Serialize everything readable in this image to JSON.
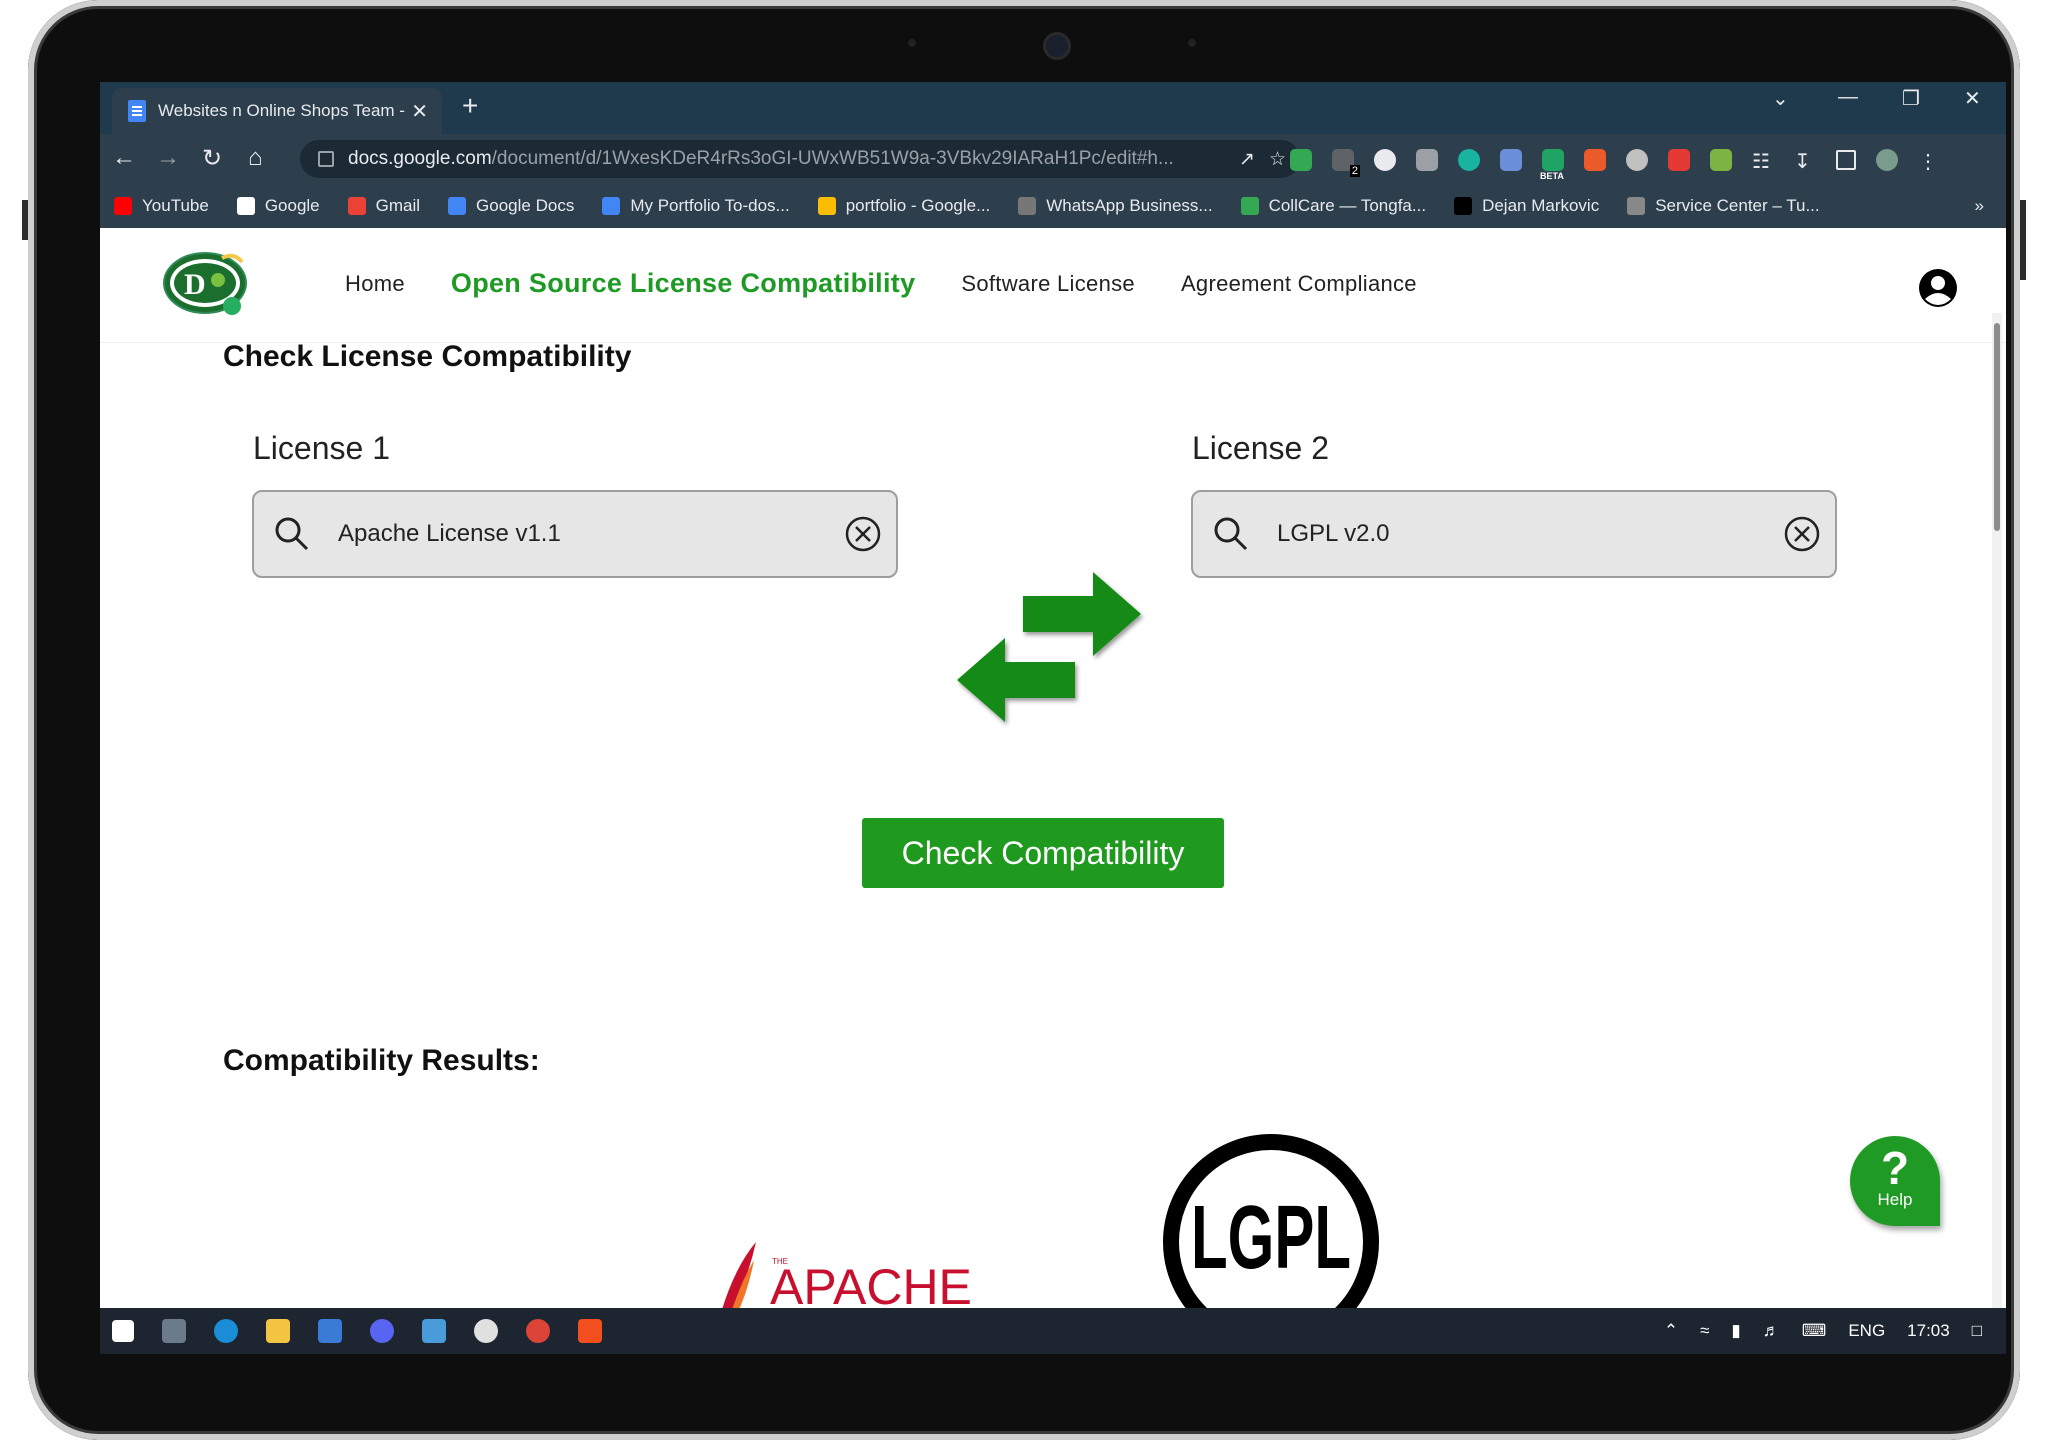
{
  "browser": {
    "tab_title": "Websites n Online Shops Team -",
    "tab_close": "✕",
    "new_tab": "+",
    "url_host": "docs.google.com",
    "url_path": "/document/d/1WxesKDeR4rRs3oGI-UWxWB51W9a-3VBkv29IARaH1Pc/edit#h...",
    "extension_badge": "2",
    "extension_beta": "BETA",
    "bookmarks": [
      {
        "label": "YouTube",
        "color": "#ff0000"
      },
      {
        "label": "Google",
        "color": "#ffffff"
      },
      {
        "label": "Gmail",
        "color": "#ea4335"
      },
      {
        "label": "Google Docs",
        "color": "#4285f4"
      },
      {
        "label": "My Portfolio To-dos...",
        "color": "#4285f4"
      },
      {
        "label": "portfolio - Google...",
        "color": "#fbbc04"
      },
      {
        "label": "WhatsApp Business...",
        "color": "#777777"
      },
      {
        "label": "CollCare — Tongfa...",
        "color": "#34a853"
      },
      {
        "label": "Dejan Markovic",
        "color": "#000000"
      },
      {
        "label": "Service Center – Tu...",
        "color": "#888888"
      }
    ],
    "bookmarks_more": "»"
  },
  "site": {
    "nav": {
      "home": "Home",
      "compat": "Open Source License Compatibility",
      "software": "Software License",
      "agreement": "Agreement Compliance"
    },
    "heading": "Check License Compatibility",
    "license1": {
      "label": "License 1",
      "value": "Apache License v1.1"
    },
    "license2": {
      "label": "License 2",
      "value": "LGPL v2.0"
    },
    "check_button": "Check Compatibility",
    "results_heading": "Compatibility Results:",
    "help_label": "Help",
    "help_mark": "?",
    "apache_logo_text": "APACHE",
    "apache_logo_the": "THE",
    "lgpl_logo_text": "LGPL"
  },
  "taskbar": {
    "lang": "ENG",
    "time": "17:03"
  },
  "colors": {
    "accent_green": "#1e9a25",
    "button_green": "#1f9a1f"
  }
}
